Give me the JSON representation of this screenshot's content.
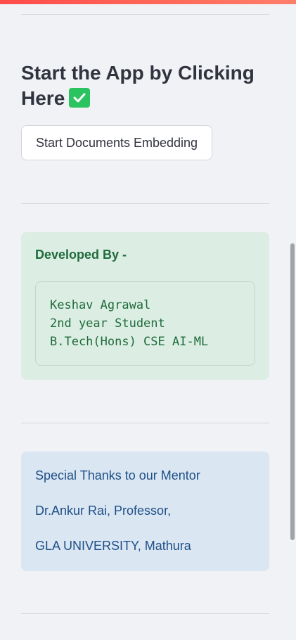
{
  "sidebar": {
    "heading": "Start the App by Clicking Here",
    "heading_icon": "check-mark-icon",
    "start_button_label": "Start Documents Embedding",
    "developer": {
      "title": "Developed By -",
      "lines": [
        "Keshav Agrawal",
        "2nd year Student",
        "B.Tech(Hons) CSE AI-ML"
      ]
    },
    "thanks": {
      "lines": [
        "Special Thanks to our Mentor",
        "Dr.Ankur Rai, Professor,",
        "GLA UNIVERSITY, Mathura"
      ]
    }
  },
  "colors": {
    "accent": "#ff4b4b",
    "success_bg": "#dceee4",
    "success_text": "#1f6b3a",
    "info_bg": "#dbe6f3",
    "info_text": "#1d4f86",
    "check_icon": "#2ac35f"
  }
}
